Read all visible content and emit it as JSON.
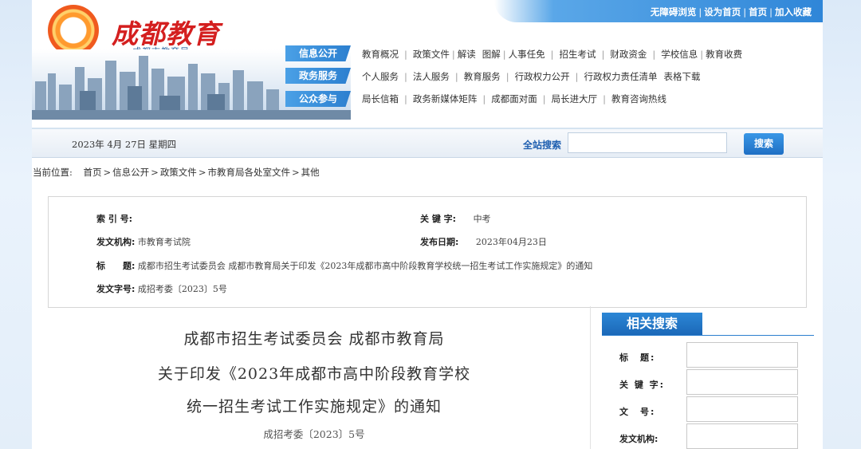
{
  "site": {
    "title": "成都教育",
    "subtitle": "成都市教育局",
    "top_links": [
      "无障碍浏览",
      "设为首页",
      "首页",
      "加入收藏"
    ]
  },
  "nav": {
    "rows": [
      {
        "tag": "信息公开",
        "items": [
          "教育概况",
          "政策文件",
          "解读",
          "图解",
          "人事任免",
          "招生考试",
          "财政资金",
          "学校信息",
          "教育收费"
        ]
      },
      {
        "tag": "政务服务",
        "items": [
          "个人服务",
          "法人服务",
          "教育服务",
          "行政权力公开",
          "行政权力责任清单",
          "表格下载"
        ]
      },
      {
        "tag": "公众参与",
        "items": [
          "局长信箱",
          "政务新媒体矩阵",
          "成都面对面",
          "局长进大厅",
          "教育咨询热线"
        ]
      }
    ]
  },
  "search": {
    "date": "2023年 4月 27日 星期四",
    "label": "全站搜索",
    "value": "",
    "button": "搜索"
  },
  "breadcrumb": {
    "prefix": "当前位置:",
    "items": [
      "首页",
      "信息公开",
      "政策文件",
      "市教育局各处室文件",
      "其他"
    ]
  },
  "info": {
    "index_label": "索 引 号:",
    "index_value": "",
    "keyword_label": "关 键 字:",
    "keyword_value": "中考",
    "issuer_label": "发文机构:",
    "issuer_value": "市教育考试院",
    "date_label": "发布日期:",
    "date_value": "2023年04月23日",
    "title_label": "标　　题:",
    "title_value": "成都市招生考试委员会 成都市教育局关于印发《2023年成都市高中阶段教育学校统一招生考试工作实施规定》的通知",
    "docno_label": "发文字号:",
    "docno_value": "成招考委〔2023〕5号"
  },
  "article": {
    "title_lines": [
      "成都市招生考试委员会  成都市教育局",
      "关于印发《2023年成都市高中阶段教育学校",
      "统一招生考试工作实施规定》的通知"
    ],
    "doc_number": "成招考委〔2023〕5号"
  },
  "related_search": {
    "header": "相关搜索",
    "fields": [
      {
        "label": "标　题:",
        "value": ""
      },
      {
        "label": "关 键 字:",
        "value": ""
      },
      {
        "label": "文　号:",
        "value": ""
      },
      {
        "label": "发文机构:",
        "value": ""
      }
    ]
  }
}
